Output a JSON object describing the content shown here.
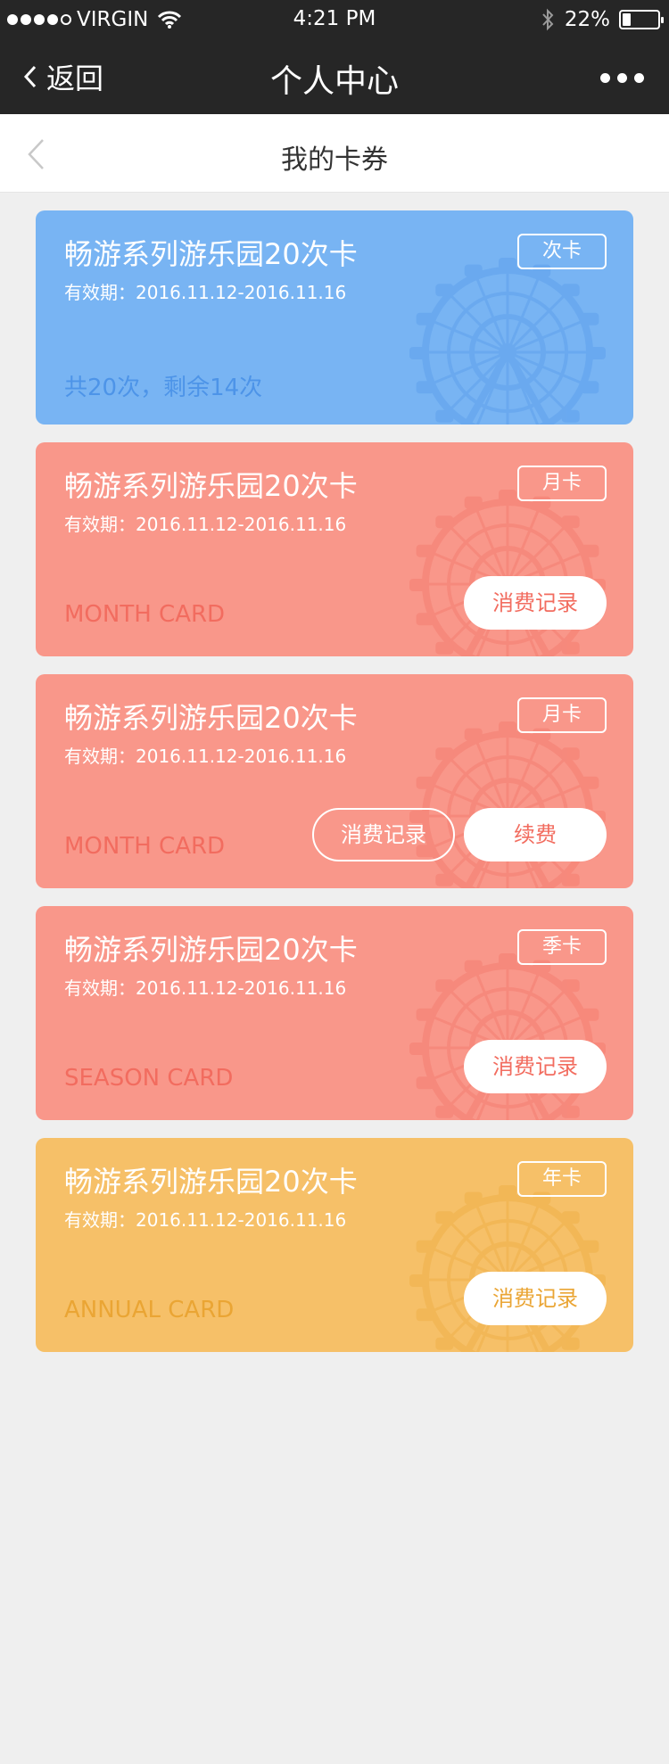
{
  "status_bar": {
    "carrier": "VIRGIN",
    "time": "4:21 PM",
    "battery": "22%",
    "battery_level": 0.22,
    "signal_bars": 4,
    "signal_total": 5
  },
  "nav": {
    "back_label": "返回",
    "title": "个人中心"
  },
  "page": {
    "title": "我的卡券"
  },
  "cards": [
    {
      "title": "畅游系列游乐园20次卡",
      "validity": "有效期：2016.11.12-2016.11.16",
      "tag": "次卡",
      "caption": "共20次，剩余14次",
      "bg": "#78b4f3",
      "accent": "#4d94e8"
    },
    {
      "title": "畅游系列游乐园20次卡",
      "validity": "有效期：2016.11.12-2016.11.16",
      "tag": "月卡",
      "caption": "MONTH CARD",
      "records_button": "消费记录",
      "bg": "#f9978a",
      "accent": "#f26c5f"
    },
    {
      "title": "畅游系列游乐园20次卡",
      "validity": "有效期：2016.11.12-2016.11.16",
      "tag": "月卡",
      "caption": "MONTH CARD",
      "records_button": "消费记录",
      "renew_button": "续费",
      "bg": "#f9978a",
      "accent": "#f26c5f"
    },
    {
      "title": "畅游系列游乐园20次卡",
      "validity": "有效期：2016.11.12-2016.11.16",
      "tag": "季卡",
      "caption": "SEASON CARD",
      "records_button": "消费记录",
      "bg": "#f9978a",
      "accent": "#f26c5f"
    },
    {
      "title": "畅游系列游乐园20次卡",
      "validity": "有效期：2016.11.12-2016.11.16",
      "tag": "年卡",
      "caption": "ANNUAL CARD",
      "records_button": "消费记录",
      "bg": "#f6c068",
      "accent": "#eaa534"
    }
  ]
}
